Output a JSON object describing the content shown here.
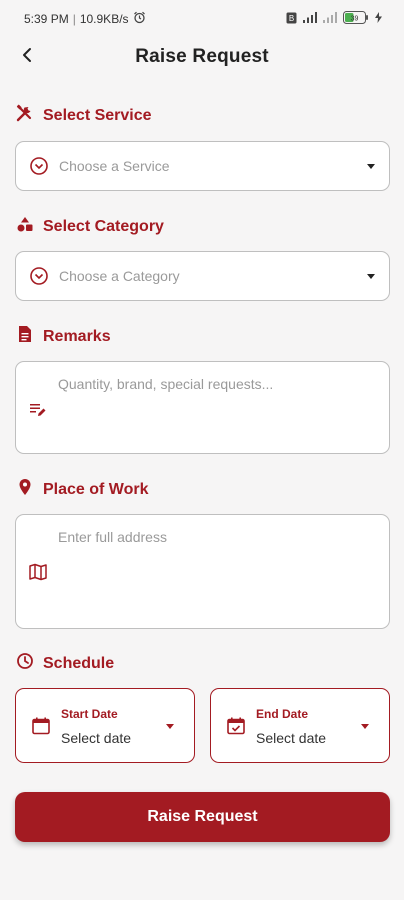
{
  "status_bar": {
    "time": "5:39 PM",
    "speed": "10.9KB/s",
    "battery_level": "39",
    "icons": [
      "alarm-icon",
      "sim-icon",
      "signal-icon",
      "wifi-icon",
      "battery-icon",
      "charging-icon"
    ]
  },
  "header": {
    "title": "Raise Request",
    "back_icon": "back-arrow-icon"
  },
  "service": {
    "label": "Select Service",
    "icon": "tools-icon",
    "placeholder": "Choose a Service"
  },
  "category": {
    "label": "Select Category",
    "icon": "shapes-icon",
    "placeholder": "Choose a Category"
  },
  "remarks": {
    "label": "Remarks",
    "icon": "document-icon",
    "placeholder": "Quantity, brand, special requests..."
  },
  "place": {
    "label": "Place of Work",
    "icon": "location-pin-icon",
    "placeholder": "Enter full address"
  },
  "schedule": {
    "label": "Schedule",
    "icon": "clock-icon",
    "start_label": "Start Date",
    "start_value": "Select date",
    "end_label": "End Date",
    "end_value": "Select date"
  },
  "submit": {
    "label": "Raise Request"
  },
  "colors": {
    "accent": "#a31b22",
    "background": "#f6f5f5",
    "border": "#bfbfbf"
  }
}
